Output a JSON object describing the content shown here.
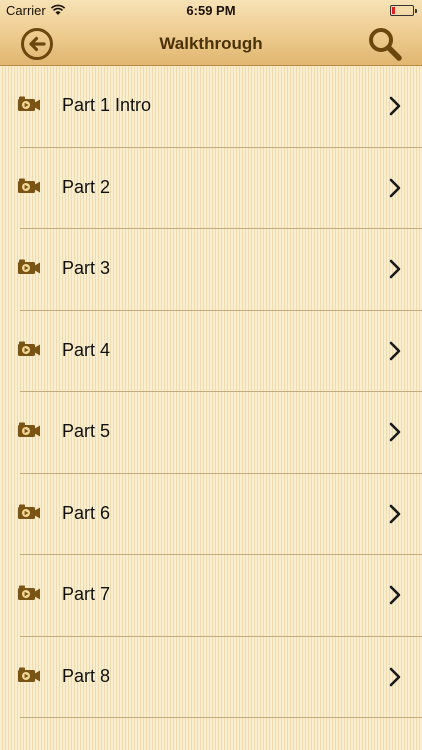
{
  "status_bar": {
    "carrier": "Carrier",
    "time": "6:59 PM",
    "battery_color": "#e02020"
  },
  "nav": {
    "title": "Walkthrough",
    "back_icon": "back-arrow-circle-icon",
    "search_icon": "search-icon"
  },
  "list": {
    "items": [
      {
        "label": "Part 1 Intro",
        "icon": "video-camera-icon"
      },
      {
        "label": "Part 2",
        "icon": "video-camera-icon"
      },
      {
        "label": "Part 3",
        "icon": "video-camera-icon"
      },
      {
        "label": "Part 4",
        "icon": "video-camera-icon"
      },
      {
        "label": "Part 5",
        "icon": "video-camera-icon"
      },
      {
        "label": "Part 6",
        "icon": "video-camera-icon"
      },
      {
        "label": "Part 7",
        "icon": "video-camera-icon"
      },
      {
        "label": "Part 8",
        "icon": "video-camera-icon"
      }
    ]
  },
  "colors": {
    "accent_brown": "#6b470f",
    "header_gold": "#efcf94"
  }
}
